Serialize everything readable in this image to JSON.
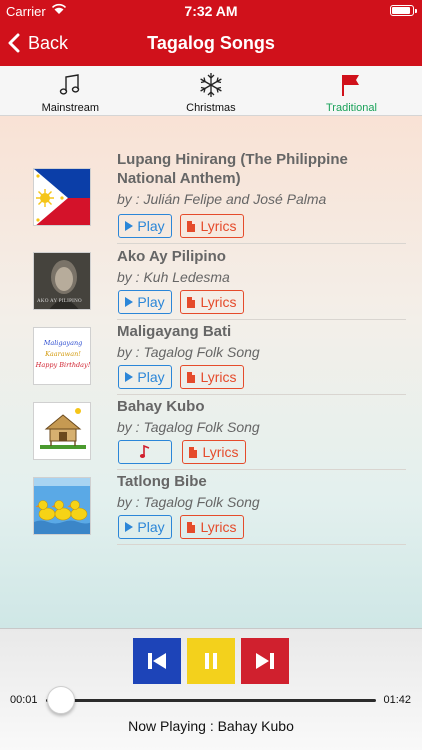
{
  "status": {
    "carrier": "Carrier",
    "time": "7:32 AM"
  },
  "nav": {
    "back_label": "Back",
    "title": "Tagalog Songs"
  },
  "tabs": [
    {
      "label": "Mainstream",
      "icon": "music-note-icon",
      "active": false
    },
    {
      "label": "Christmas",
      "icon": "snowflake-icon",
      "active": false
    },
    {
      "label": "Traditional",
      "icon": "flag-icon",
      "active": true
    }
  ],
  "songs": [
    {
      "title": "Lupang Hinirang (The Philippine National Anthem)",
      "artist": "by : Julián Felipe and José Palma",
      "play_label": "Play",
      "lyrics_label": "Lyrics",
      "thumb": "philippine-flag"
    },
    {
      "title": "Ako Ay Pilipino",
      "artist": "by : Kuh Ledesma",
      "play_label": "Play",
      "lyrics_label": "Lyrics",
      "thumb": "album-cover",
      "thumb_caption": "AKO AY PILIPINO"
    },
    {
      "title": "Maligayang Bati",
      "artist": "by : Tagalog Folk Song",
      "play_label": "Play",
      "lyrics_label": "Lyrics",
      "thumb": "greeting-card",
      "thumb_lines": [
        "Maligayang",
        "Kaarawan!",
        "Happy Birthday!"
      ]
    },
    {
      "title": "Bahay Kubo",
      "artist": "by : Tagalog Folk Song",
      "play_label": "",
      "lyrics_label": "Lyrics",
      "thumb": "nipa-hut",
      "now_playing": true
    },
    {
      "title": "Tatlong Bibe",
      "artist": "by : Tagalog Folk Song",
      "play_label": "Play",
      "lyrics_label": "Lyrics",
      "thumb": "three-ducks"
    }
  ],
  "player": {
    "elapsed": "00:01",
    "duration": "01:42",
    "progress": 0.01,
    "now_playing": "Now Playing : Bahay Kubo"
  },
  "colors": {
    "header": "#d0111b",
    "active_tab": "#1aa25a",
    "play": "#2b86d8",
    "lyrics": "#e54b2b",
    "prev": "#1d44b8",
    "pause": "#f3d11c",
    "next": "#d0202e"
  }
}
